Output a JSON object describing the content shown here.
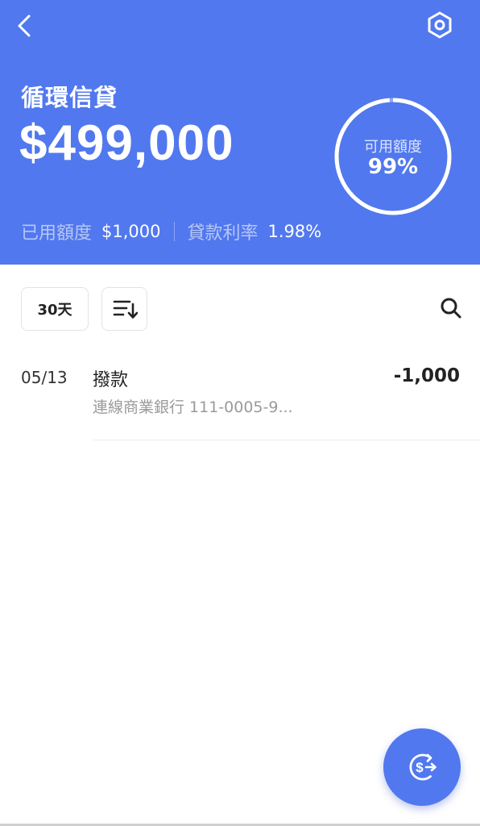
{
  "header": {
    "title": "循環信貸",
    "amount": "$499,000",
    "ring": {
      "label": "可用額度",
      "value": "99%",
      "fraction": 0.99
    },
    "used_label": "已用額度",
    "used_value": "$1,000",
    "rate_label": "貸款利率",
    "rate_value": "1.98%"
  },
  "icons": {
    "back": "chevron-left-icon",
    "settings": "hexagon-gear-icon",
    "sort": "sort-descending-icon",
    "search": "search-icon",
    "fab": "dollar-transfer-icon"
  },
  "filters": {
    "days_label": "30天"
  },
  "transactions": [
    {
      "date": "05/13",
      "title": "撥款",
      "subtitle": "連線商業銀行 111-0005-9...",
      "amount": "-1,000"
    }
  ],
  "colors": {
    "primary": "#5178ee",
    "text": "#222222",
    "muted": "#9a9a9a"
  }
}
